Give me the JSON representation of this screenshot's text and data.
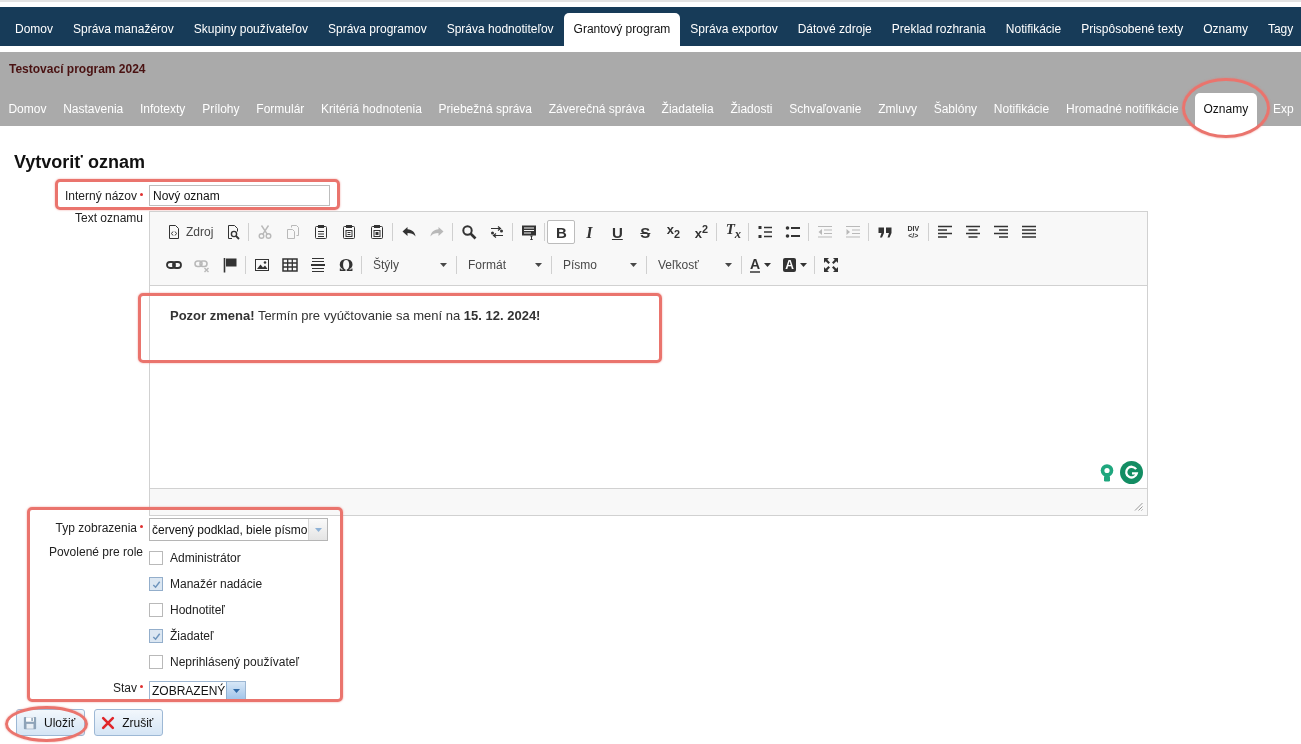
{
  "top_nav": {
    "items": [
      {
        "label": "Domov",
        "selected": false
      },
      {
        "label": "Správa manažérov",
        "selected": false
      },
      {
        "label": "Skupiny používateľov",
        "selected": false
      },
      {
        "label": "Správa programov",
        "selected": false
      },
      {
        "label": "Správa hodnotiteľov",
        "selected": false
      },
      {
        "label": "Grantový program",
        "selected": true
      },
      {
        "label": "Správa exportov",
        "selected": false
      },
      {
        "label": "Dátové zdroje",
        "selected": false
      },
      {
        "label": "Preklad rozhrania",
        "selected": false
      },
      {
        "label": "Notifikácie",
        "selected": false
      },
      {
        "label": "Prispôsobené texty",
        "selected": false
      },
      {
        "label": "Oznamy",
        "selected": false
      },
      {
        "label": "Tagy",
        "selected": false
      }
    ]
  },
  "program": {
    "title": "Testovací program 2024",
    "tabs": [
      {
        "label": "Domov",
        "selected": false,
        "circled": false
      },
      {
        "label": "Nastavenia",
        "selected": false,
        "circled": false
      },
      {
        "label": "Infotexty",
        "selected": false,
        "circled": false
      },
      {
        "label": "Prílohy",
        "selected": false,
        "circled": false
      },
      {
        "label": "Formulár",
        "selected": false,
        "circled": false
      },
      {
        "label": "Kritériá hodnotenia",
        "selected": false,
        "circled": false
      },
      {
        "label": "Priebežná správa",
        "selected": false,
        "circled": false
      },
      {
        "label": "Záverečná správa",
        "selected": false,
        "circled": false
      },
      {
        "label": "Žiadatelia",
        "selected": false,
        "circled": false
      },
      {
        "label": "Žiadosti",
        "selected": false,
        "circled": false
      },
      {
        "label": "Schvaľovanie",
        "selected": false,
        "circled": false
      },
      {
        "label": "Zmluvy",
        "selected": false,
        "circled": false
      },
      {
        "label": "Šablóny",
        "selected": false,
        "circled": false
      },
      {
        "label": "Notifikácie",
        "selected": false,
        "circled": false
      },
      {
        "label": "Hromadné notifikácie",
        "selected": false,
        "circled": false
      },
      {
        "label": "Oznamy",
        "selected": true,
        "circled": true
      },
      {
        "label": "Exp",
        "selected": false,
        "circled": false
      }
    ]
  },
  "page_title": "Vytvoriť oznam",
  "form": {
    "name": {
      "label": "Interný názov",
      "required": true,
      "value": "Nový oznam",
      "highlighted": true
    },
    "text": {
      "label": "Text oznamu",
      "toolbar": {
        "rows": [
          [
            [
              {
                "kind": "source",
                "label": "Zdroj",
                "disabled": false,
                "pressed": false
              },
              {
                "kind": "preview",
                "disabled": false,
                "pressed": false
              }
            ],
            [
              {
                "kind": "cut",
                "disabled": true,
                "pressed": false
              },
              {
                "kind": "copy",
                "disabled": true,
                "pressed": false
              },
              {
                "kind": "paste",
                "disabled": false,
                "pressed": false
              },
              {
                "kind": "paste-text",
                "disabled": false,
                "pressed": false
              },
              {
                "kind": "paste-word",
                "disabled": false,
                "pressed": false
              }
            ],
            [
              {
                "kind": "undo",
                "disabled": false,
                "pressed": false
              },
              {
                "kind": "redo",
                "disabled": true,
                "pressed": false
              }
            ],
            [
              {
                "kind": "find",
                "disabled": false,
                "pressed": false
              },
              {
                "kind": "replace",
                "disabled": false,
                "pressed": false
              }
            ],
            [
              {
                "kind": "select-all",
                "disabled": false,
                "pressed": false
              }
            ],
            [
              {
                "kind": "bold",
                "glyph": "B",
                "disabled": false,
                "pressed": true
              },
              {
                "kind": "italic",
                "glyph": "I",
                "disabled": false,
                "pressed": false
              },
              {
                "kind": "underline",
                "glyph": "U",
                "disabled": false,
                "pressed": false
              },
              {
                "kind": "strike",
                "glyph": "S",
                "disabled": false,
                "pressed": false
              },
              {
                "kind": "subscript",
                "glyph": "x$_{2}$",
                "disabled": false,
                "pressed": false
              },
              {
                "kind": "superscript",
                "glyph": "x$^{2}$",
                "disabled": false,
                "pressed": false
              }
            ],
            [
              {
                "kind": "remove-format",
                "glyph": "T$_{x}$",
                "disabled": false,
                "pressed": false
              }
            ],
            [
              {
                "kind": "numbered-list",
                "disabled": false,
                "pressed": false
              },
              {
                "kind": "bulleted-list",
                "disabled": false,
                "pressed": false
              }
            ],
            [
              {
                "kind": "outdent",
                "disabled": true,
                "pressed": false
              },
              {
                "kind": "indent",
                "disabled": true,
                "pressed": false
              }
            ],
            [
              {
                "kind": "blockquote",
                "disabled": false,
                "pressed": false
              },
              {
                "kind": "div",
                "lines": [
                  "DIV",
                  "</>"
                ],
                "disabled": false,
                "pressed": false
              }
            ],
            [
              {
                "kind": "align-left",
                "disabled": false,
                "pressed": false
              },
              {
                "kind": "align-center",
                "disabled": false,
                "pressed": false
              },
              {
                "kind": "align-right",
                "disabled": false,
                "pressed": false
              },
              {
                "kind": "justify",
                "disabled": false,
                "pressed": false
              }
            ]
          ],
          [
            [
              {
                "kind": "link",
                "disabled": false,
                "pressed": false
              },
              {
                "kind": "unlink",
                "disabled": true,
                "pressed": false
              },
              {
                "kind": "anchor",
                "disabled": false,
                "pressed": false
              }
            ],
            [
              {
                "kind": "image",
                "disabled": false,
                "pressed": false
              },
              {
                "kind": "table",
                "disabled": false,
                "pressed": false
              },
              {
                "kind": "horizontal-line",
                "disabled": false,
                "pressed": false
              },
              {
                "kind": "special-char",
                "glyph": "Ω",
                "disabled": false,
                "pressed": false
              }
            ],
            [
              {
                "kind": "dropdown",
                "label": "Štýly"
              }
            ],
            [
              {
                "kind": "dropdown",
                "label": "Formát"
              }
            ],
            [
              {
                "kind": "dropdown",
                "label": "Písmo"
              }
            ],
            [
              {
                "kind": "dropdown",
                "label": "Veľkosť"
              }
            ],
            [
              {
                "kind": "text-color",
                "glyph": "A",
                "disabled": false,
                "pressed": false
              },
              {
                "kind": "bg-color",
                "glyph": "A",
                "disabled": false,
                "pressed": false
              }
            ],
            [
              {
                "kind": "maximize",
                "disabled": false,
                "pressed": false
              }
            ]
          ]
        ]
      },
      "content": "**Pozor zmena!** Termín pre vyúčtovanie sa mení na **15. 12. 2024!**",
      "content_highlighted": true
    },
    "settings": {
      "highlighted": true,
      "display_type": {
        "label": "Typ zobrazenia",
        "required": true,
        "value": "červený podklad, biele písmo"
      },
      "roles": {
        "label": "Povolené pre role",
        "options": [
          {
            "label": "Administrátor",
            "checked": false
          },
          {
            "label": "Manažér nadácie",
            "checked": true
          },
          {
            "label": "Hodnotiteľ",
            "checked": false
          },
          {
            "label": "Žiadateľ",
            "checked": true
          },
          {
            "label": "Neprihlásený používateľ",
            "checked": false
          }
        ]
      },
      "status": {
        "label": "Stav",
        "required": true,
        "value": "ZOBRAZENÝ"
      }
    }
  },
  "buttons": [
    {
      "kind": "save",
      "label": "Uložiť",
      "circled": true
    },
    {
      "kind": "cancel",
      "label": "Zrušiť",
      "circled": false
    }
  ]
}
